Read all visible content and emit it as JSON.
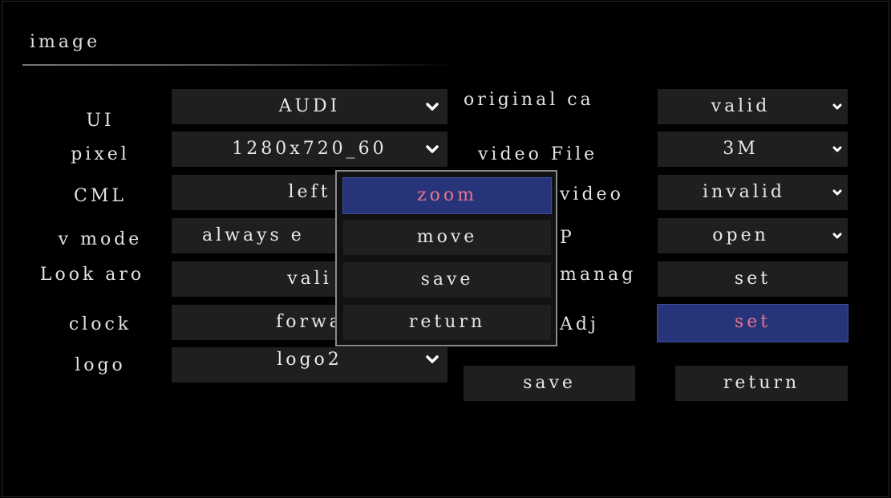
{
  "header": {
    "title": "image"
  },
  "left_rows": [
    {
      "label": "UI",
      "value": "AUDI"
    },
    {
      "label": "pixel",
      "value": "1280x720_60"
    },
    {
      "label": "CML",
      "value": "left"
    },
    {
      "label": "v mode",
      "value": "always e"
    },
    {
      "label": "Look aro",
      "value": "vali"
    },
    {
      "label": "clock",
      "value": "forwa"
    },
    {
      "label": "logo",
      "value": "logo2"
    }
  ],
  "right_rows": [
    {
      "label": "original ca",
      "value": "valid"
    },
    {
      "label": "video File",
      "value": "3M"
    },
    {
      "label": "video",
      "value": "invalid"
    },
    {
      "label": "P",
      "value": "open"
    },
    {
      "label": "manag",
      "value": "set"
    },
    {
      "label": "Adj",
      "value": "set"
    }
  ],
  "footer": {
    "save_label": "save",
    "return_label": "return"
  },
  "popup": {
    "items": [
      {
        "label": "zoom",
        "active": true
      },
      {
        "label": "move"
      },
      {
        "label": "save"
      },
      {
        "label": "return"
      }
    ]
  },
  "colors": {
    "accent": "#283479",
    "accent_text": "#e7748f",
    "field_bg": "#1e1f21"
  }
}
